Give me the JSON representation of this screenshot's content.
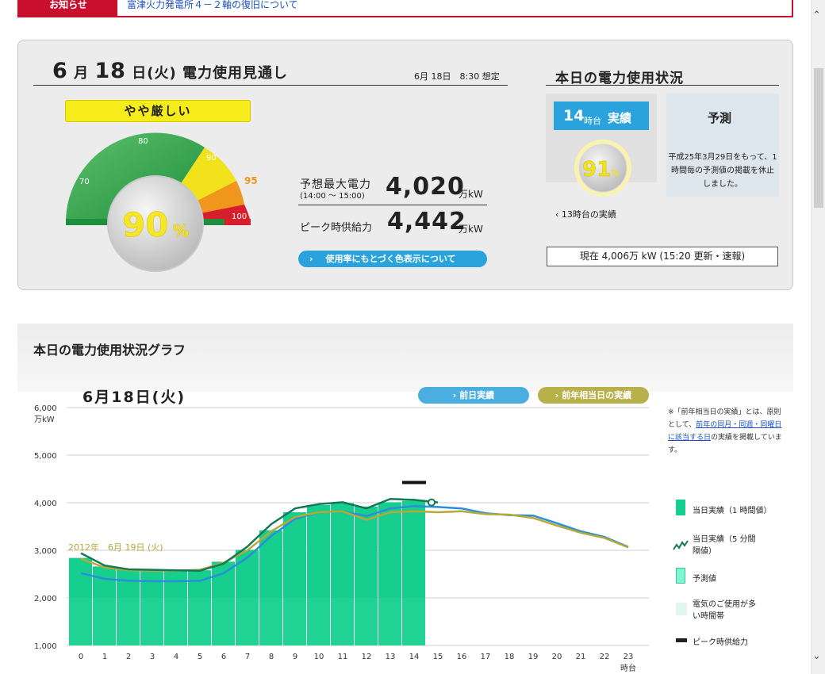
{
  "notice": {
    "label": "お知らせ",
    "link": "富津火力発電所４－２軸の復旧について"
  },
  "outlook": {
    "month": "6",
    "month_unit": "月",
    "day": "18",
    "day_unit": "日",
    "weekday": "(火)",
    "title_suffix": "電力使用見通し",
    "assumed": "6月 18日　8:30 想定",
    "status": "やや厳しい",
    "usage_percent": "90",
    "percent_unit": "%",
    "gauge_ticks": [
      "70",
      "80",
      "90",
      "95",
      "100"
    ],
    "forecast_label": "予想最大電力",
    "forecast_time": "(14:00 ～ 15:00)",
    "forecast_value": "4,020",
    "unit": "万kW",
    "peak_label": "ピーク時供給力",
    "peak_value": "4,442",
    "color_info_button": "使用率にもとづく色表示について"
  },
  "today": {
    "title": "本日の電力使用状況",
    "actual_hour": "14",
    "actual_hour_unit": "時台",
    "actual_label": "実績",
    "actual_percent": "91",
    "prev_hour_link": "13時台の実績",
    "predict_title": "予測",
    "predict_message": "平成25年3月29日をもって、1時間毎の予測値の掲載を休止しました。",
    "now_text": "現在 4,006万 kW (15:20 更新・速報)"
  },
  "graph": {
    "title": "本日の電力使用状況グラフ",
    "date": "6月18日(火)",
    "btn_prev_day": "前日実績",
    "btn_prev_year": "前年相当日の実績",
    "prev_year_label": "2012年　6月 19日 (火)",
    "note_1": "※「前年相当日の実績」とは、原則として、",
    "note_link": "前年の同月・同週・同曜日に該当する日",
    "note_2": "の実績を掲載しています。",
    "legend": [
      "当日実績（1 時間値）",
      "当日実績（5 分間隔値）",
      "予測値",
      "電気のご使用が多い時間帯",
      "ピーク時供給力"
    ],
    "colors": {
      "actual_bar": "#16cf8e",
      "five_min": "#137a55",
      "prev_day": "#2a8fd6",
      "prev_year": "#b5a93a",
      "forecast": "#7ff5d0"
    }
  },
  "chart_data": {
    "type": "bar",
    "title": "6月18日(火)",
    "ylabel": "万kW",
    "xlabel": "時台",
    "ylim": [
      1000,
      6000
    ],
    "yticks": [
      "1,000",
      "2,000",
      "3,000",
      "4,000",
      "5,000",
      "6,000"
    ],
    "categories": [
      "0",
      "1",
      "2",
      "3",
      "4",
      "5",
      "6",
      "7",
      "8",
      "9",
      "10",
      "11",
      "12",
      "13",
      "14",
      "15",
      "16",
      "17",
      "18",
      "19",
      "20",
      "21",
      "22",
      "23"
    ],
    "series": [
      {
        "name": "当日実績（1 時間値）",
        "values": [
          2840,
          2660,
          2600,
          2590,
          2580,
          2580,
          2760,
          3010,
          3420,
          3800,
          3950,
          3990,
          3920,
          4010,
          4040,
          null,
          null,
          null,
          null,
          null,
          null,
          null,
          null,
          null
        ]
      },
      {
        "name": "当日実績（5 分間隔値）",
        "values": [
          2940,
          2680,
          2600,
          2590,
          2580,
          2570,
          2720,
          3080,
          3550,
          3880,
          3970,
          4010,
          3880,
          4080,
          4060,
          4006,
          null,
          null,
          null,
          null,
          null,
          null,
          null,
          null
        ]
      },
      {
        "name": "前日実績",
        "values": [
          2520,
          2400,
          2360,
          2350,
          2350,
          2360,
          2520,
          2850,
          3300,
          3660,
          3800,
          3820,
          3720,
          3880,
          3930,
          3910,
          3880,
          3780,
          3740,
          3730,
          3570,
          3400,
          3280,
          3070
        ]
      },
      {
        "name": "2012年　6月 19日 (火)",
        "values": [
          2820,
          2640,
          2580,
          2570,
          2570,
          2590,
          2740,
          3000,
          3400,
          3700,
          3800,
          3820,
          3640,
          3800,
          3820,
          3800,
          3820,
          3760,
          3750,
          3680,
          3520,
          3370,
          3260,
          3060
        ]
      },
      {
        "name": "ピーク時供給力",
        "values": [
          4442
        ]
      }
    ],
    "peak_hour": "14"
  }
}
